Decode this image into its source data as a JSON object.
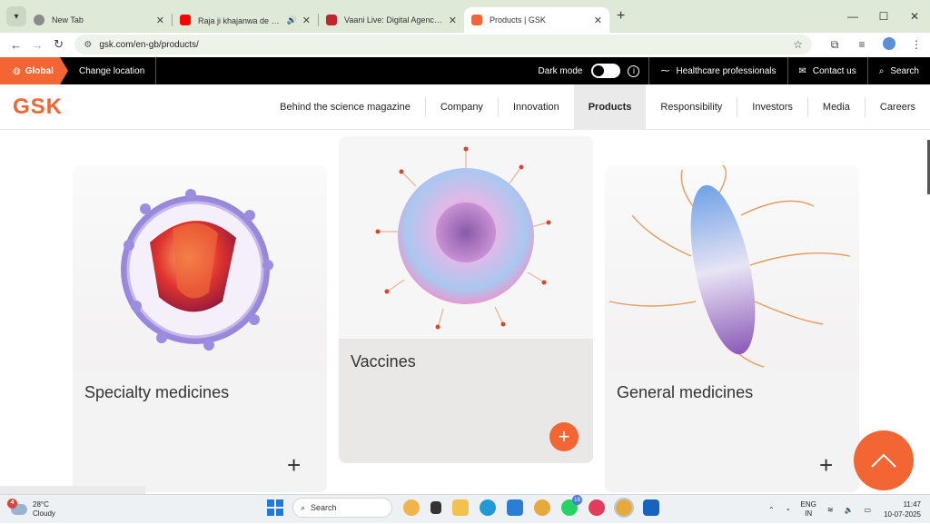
{
  "browser": {
    "tabs": [
      {
        "title": "New Tab",
        "active": false,
        "favicon_color": "#6b6b6b"
      },
      {
        "title": "Raja ji khajanwa de da | रा",
        "active": false,
        "favicon_color": "#ff0000",
        "audio": true
      },
      {
        "title": "Vaani Live: Digital Agency, Web",
        "active": false,
        "favicon_color": "#c0262d"
      },
      {
        "title": "Products | GSK",
        "active": true,
        "favicon_color": "#f36633"
      }
    ],
    "new_tab_label": "+",
    "url": "gsk.com/en-gb/products/"
  },
  "gsk_top": {
    "global_label": "Global",
    "change_location": "Change location",
    "dark_mode": "Dark mode",
    "healthcare": "Healthcare professionals",
    "contact": "Contact us",
    "search": "Search"
  },
  "gsk_nav": {
    "logo": "GSK",
    "items": [
      "Behind the science magazine",
      "Company",
      "Innovation",
      "Products",
      "Responsibility",
      "Investors",
      "Media",
      "Careers"
    ],
    "active_item": "Products"
  },
  "cards": [
    {
      "label": "Specialty medicines",
      "plus": "+"
    },
    {
      "label": "Vaccines",
      "plus": "+"
    },
    {
      "label": "General medicines",
      "plus": "+"
    }
  ],
  "taskbar": {
    "weather_temp": "28°C",
    "weather_cond": "Cloudy",
    "weather_badge": "4",
    "search_label": "Search",
    "whatsapp_badge": "19",
    "lang_top": "ENG",
    "lang_bottom": "IN",
    "time": "11:47",
    "date": "10-07-2025"
  },
  "colors": {
    "brand_orange": "#f36633",
    "top_bar": "#000000",
    "chrome_tabbar": "#dfe9d8"
  }
}
